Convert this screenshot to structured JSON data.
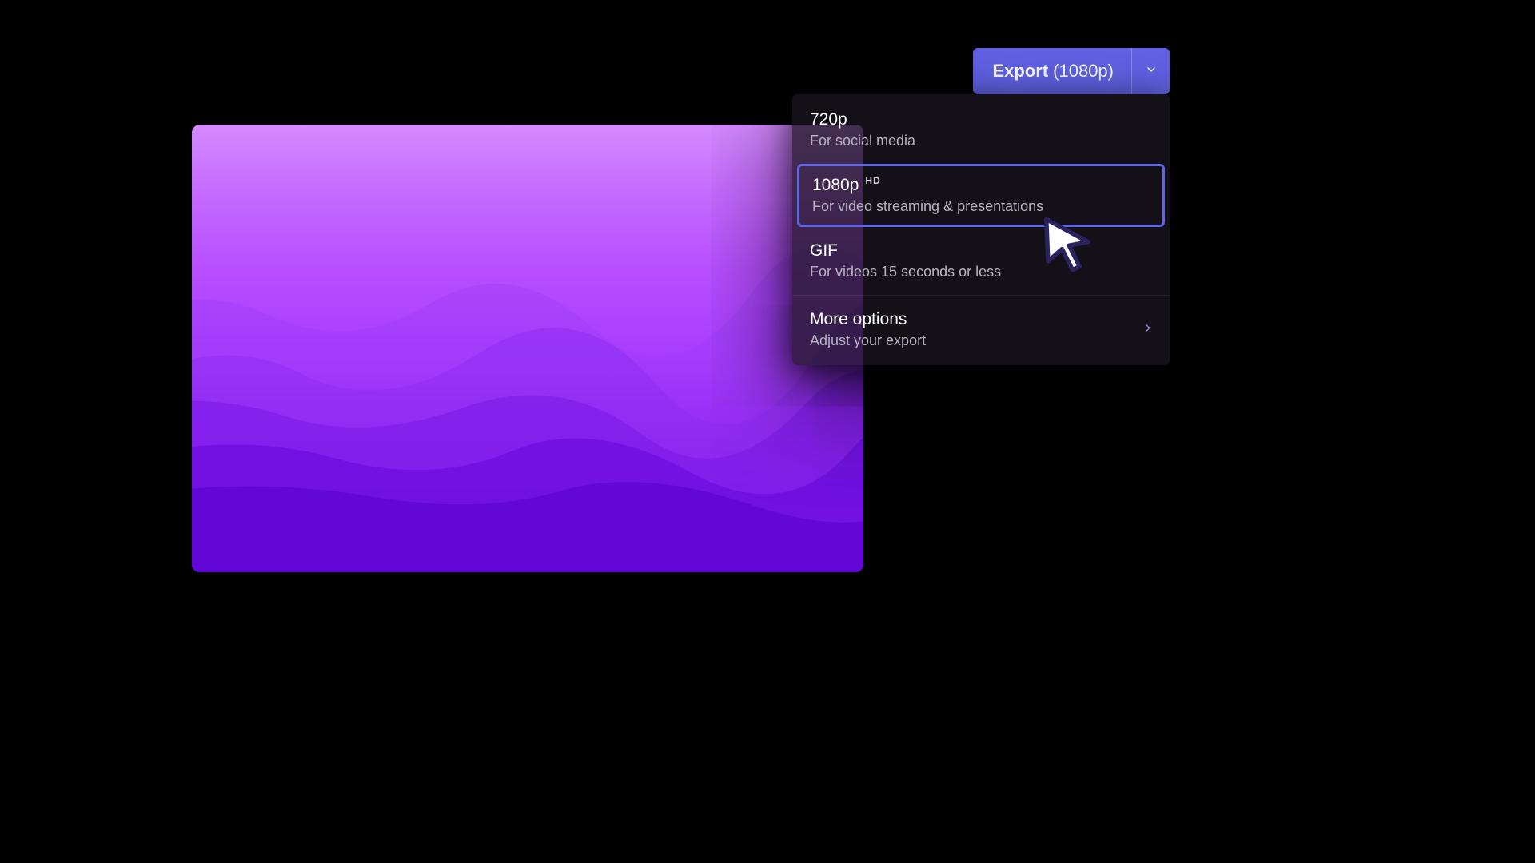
{
  "export_button": {
    "label": "Export",
    "resolution": "(1080p)"
  },
  "menu": {
    "items": [
      {
        "title": "720p",
        "subtitle": "For social media",
        "selected": false,
        "badge": null
      },
      {
        "title": "1080p",
        "subtitle": "For video streaming & presentations",
        "selected": true,
        "badge": "HD"
      },
      {
        "title": "GIF",
        "subtitle": "For videos 15 seconds or less",
        "selected": false,
        "badge": null
      }
    ],
    "more": {
      "title": "More options",
      "subtitle": "Adjust your export"
    }
  },
  "colors": {
    "accent": "#6264e8",
    "panel_bg": "rgba(25,20,30,0.78)",
    "text_secondary": "#b9b3c2"
  }
}
